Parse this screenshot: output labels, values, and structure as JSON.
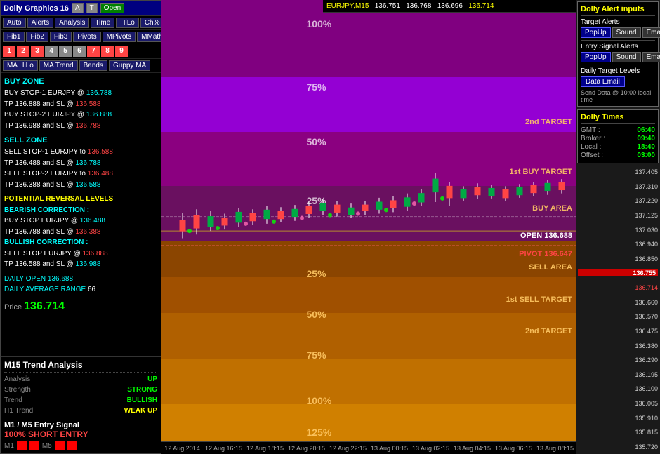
{
  "header": {
    "symbol": "EURJPY,M15",
    "price1": "136.751",
    "price2": "136.768",
    "price3": "136.696",
    "price4": "136.714"
  },
  "left_panel": {
    "title": "Dolly Graphics 16",
    "btn_a": "A",
    "btn_t": "T",
    "btn_open": "Open",
    "toolbar1": [
      "Auto",
      "Alerts",
      "Analysis",
      "Time",
      "HiLo",
      "Ch%"
    ],
    "toolbar2": [
      "Fib1",
      "Fib2",
      "Fib3",
      "Pivots",
      "MPivots",
      "MMath"
    ],
    "numbers": [
      "1",
      "2",
      "3",
      "4",
      "5",
      "6",
      "7",
      "8",
      "9"
    ],
    "toolbar3": [
      "MA HiLo",
      "MA Trend",
      "Bands",
      "Guppy MA"
    ],
    "buy_zone_title": "BUY ZONE",
    "buy_stop1_label": "BUY STOP-1 EURJPY @",
    "buy_stop1_val": "136.788",
    "buy_stop1_tp": "TP 136.888",
    "buy_stop1_sl": "136.588",
    "buy_stop2_label": "BUY STOP-2 EURJPY @",
    "buy_stop2_val": "136.888",
    "buy_stop2_tp": "TP 136.988",
    "buy_stop2_sl": "136.788",
    "sell_zone_title": "SELL ZONE",
    "sell_stop1_label": "SELL STOP-1 EURJPY to",
    "sell_stop1_val": "136.588",
    "sell_stop1_tp": "TP 136.488",
    "sell_stop1_sl": "136.788",
    "sell_stop2_label": "SELL STOP-2 EURJPY to",
    "sell_stop2_val": "136.488",
    "sell_stop2_tp": "TP 136.388",
    "sell_stop2_sl": "136.588",
    "potential_title": "POTENTIAL REVERSAL LEVELS",
    "bearish_title": "BEARISH CORRECTION :",
    "bearish_buy": "BUY STOP EURJPY @",
    "bearish_buy_val": "136.488",
    "bearish_tp": "TP 136.788",
    "bearish_sl": "136.388",
    "bullish_title": "BULLISH CORRECTION :",
    "bullish_sell": "SELL STOP EURJPY @",
    "bullish_sell_val": "136.888",
    "bullish_tp": "TP 136.588",
    "bullish_sl": "136.988",
    "daily_open_label": "DAILY OPEN",
    "daily_open_val": "136.688",
    "daily_avg_label": "DAILY AVERAGE RANGE",
    "daily_avg_val": "66",
    "price_label": "Price",
    "price_val": "136.714"
  },
  "trend_panel": {
    "title": "M15 Trend Analysis",
    "analysis_label": "Analysis",
    "analysis_val": "UP",
    "strength_label": "Strength",
    "strength_val": "STRONG",
    "trend_label": "Trend",
    "trend_val": "BULLISH",
    "h1_label": "H1 Trend",
    "h1_val": "WEAK UP",
    "entry_title": "M1 / M5 Entry Signal",
    "entry_val": "100% SHORT ENTRY",
    "m1_label": "M1",
    "m5_label": "M5"
  },
  "chart": {
    "zones": {
      "buy_100": "100%",
      "buy_75": "75%",
      "buy_50": "50%",
      "target_2nd": "2nd TARGET",
      "target_1st_buy": "1st BUY TARGET",
      "buy_25": "25%",
      "buy_area": "BUY AREA",
      "open": "OPEN 136.688",
      "pivot": "PIVOT 136.647",
      "sell_area": "SELL AREA",
      "target_1st_sell": "1st SELL TARGET",
      "target_2nd_sell": "2nd TARGET",
      "sell_25": "25%",
      "sell_50": "50%",
      "sell_75": "75%",
      "sell_100": "100%",
      "sell_125": "125%"
    },
    "x_labels": [
      "12 Aug 2014",
      "12 Aug 16:15",
      "12 Aug 18:15",
      "12 Aug 20:15",
      "12 Aug 22:15",
      "13 Aug 00:15",
      "13 Aug 02:15",
      "13 Aug 04:15",
      "13 Aug 06:15",
      "13 Aug 08:15"
    ]
  },
  "right_panel": {
    "alert_title": "Dolly Alert inputs",
    "target_alerts_label": "Target Alerts",
    "btn_popup": "PopUp",
    "btn_sound": "Sound",
    "btn_email": "Email",
    "entry_signal_label": "Entry Signal Alerts",
    "daily_target_label": "Daily Target Levels",
    "data_email_btn": "Data Email",
    "send_data_text": "Send Data @ 10:00 local time",
    "times_title": "Dolly Times",
    "gmt_label": "GMT :",
    "gmt_val": "06:40",
    "broker_label": "Broker :",
    "broker_val": "09:40",
    "local_label": "Local :",
    "local_val": "18:40",
    "offset_label": "Offset :",
    "offset_val": "03:00",
    "price_scale": [
      "137.405",
      "137.310",
      "137.220",
      "137.125",
      "137.030",
      "136.940",
      "136.850",
      "136.755",
      "136.660",
      "136.570",
      "136.475",
      "136.380",
      "136.290",
      "136.195",
      "136.100",
      "136.005",
      "135.910",
      "135.815",
      "135.720"
    ]
  }
}
